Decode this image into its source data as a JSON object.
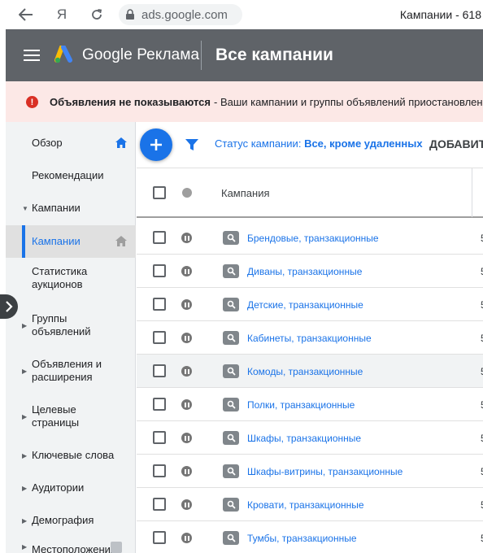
{
  "browser": {
    "url": "ads.google.com",
    "tab_title": "Кампании - 618",
    "ya_glyph": "Я"
  },
  "header": {
    "brand": "Google Реклама",
    "title": "Все кампании"
  },
  "alert": {
    "strong": "Объявления не показываются",
    "text": "- Ваши кампании и группы объявлений приостановлены"
  },
  "sidebar": {
    "items": [
      {
        "label": "Обзор"
      },
      {
        "label": "Рекомендации"
      },
      {
        "label": "Кампании"
      },
      {
        "label": "Кампании"
      },
      {
        "label": "Статистика аукционов"
      },
      {
        "label": "Группы объявлений"
      },
      {
        "label": "Объявления и расширения"
      },
      {
        "label": "Целевые страницы"
      },
      {
        "label": "Ключевые слова"
      },
      {
        "label": "Аудитории"
      },
      {
        "label": "Демография"
      },
      {
        "label": "Местоположения"
      }
    ]
  },
  "toolbar": {
    "filter_label": "Статус кампании:",
    "filter_value": "Все, кроме удаленных",
    "add_filter": "ДОБАВИТ"
  },
  "table": {
    "header": "Кампания",
    "rows": [
      {
        "name": "Брендовые, транзакционные",
        "extra": "5"
      },
      {
        "name": "Диваны, транзакционные",
        "extra": "5"
      },
      {
        "name": "Детские, транзакционные",
        "extra": "5"
      },
      {
        "name": "Кабинеты, транзакционные",
        "extra": "5"
      },
      {
        "name": "Комоды, транзакционные",
        "extra": "5"
      },
      {
        "name": "Полки, транзакционные",
        "extra": "5"
      },
      {
        "name": "Шкафы, транзакционные",
        "extra": "5"
      },
      {
        "name": "Шкафы-витрины, транзакционные",
        "extra": "5"
      },
      {
        "name": "Кровати, транзакционные",
        "extra": "5"
      },
      {
        "name": "Тумбы, транзакционные",
        "extra": "5"
      }
    ]
  },
  "colors": {
    "accent": "#1a73e8",
    "header_bg": "#5f6368",
    "alert_bg": "#fce8e6",
    "alert_icon": "#d93025"
  }
}
